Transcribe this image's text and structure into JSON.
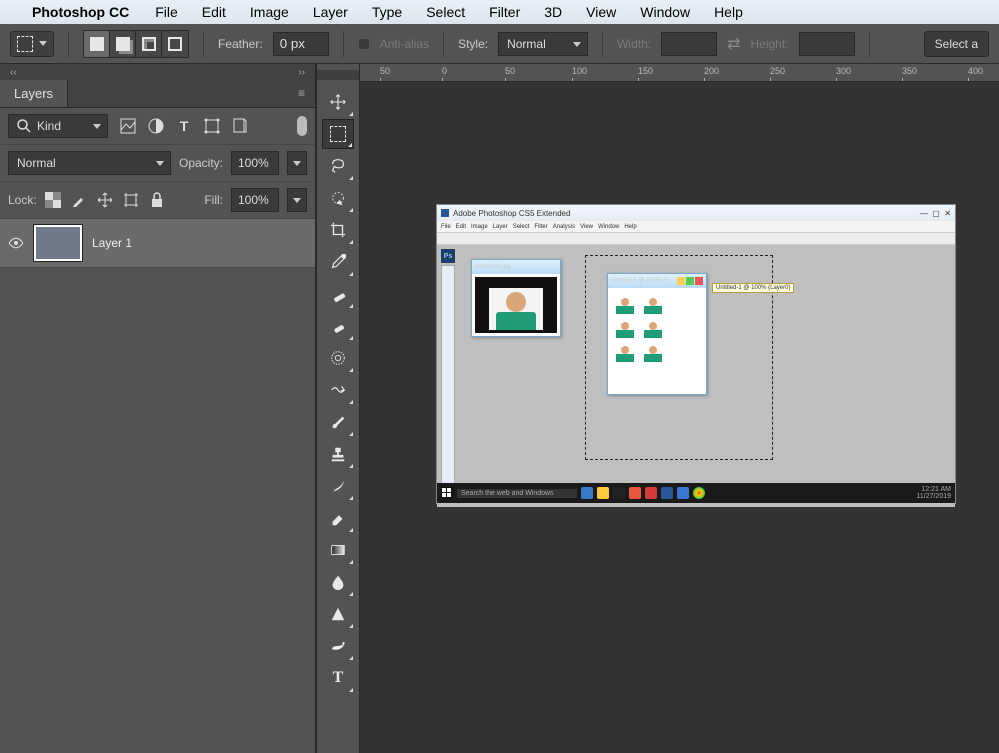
{
  "menubar": {
    "app_name": "Photoshop CC",
    "items": [
      "File",
      "Edit",
      "Image",
      "Layer",
      "Type",
      "Select",
      "Filter",
      "3D",
      "View",
      "Window",
      "Help"
    ]
  },
  "optionsbar": {
    "feather_label": "Feather:",
    "feather_value": "0 px",
    "antialias_label": "Anti-alias",
    "style_label": "Style:",
    "style_value": "Normal",
    "width_label": "Width:",
    "width_value": "",
    "height_label": "Height:",
    "height_value": "",
    "select_all": "Select a"
  },
  "layers_panel": {
    "tab": "Layers",
    "kind_label": "Kind",
    "blend_mode": "Normal",
    "opacity_label": "Opacity:",
    "opacity_value": "100%",
    "lock_label": "Lock:",
    "fill_label": "Fill:",
    "fill_value": "100%",
    "layers": [
      {
        "name": "Layer 1",
        "visible": true
      }
    ]
  },
  "collapse": {
    "left": "‹‹",
    "right": "››"
  },
  "ruler_ticks": [
    "50",
    "0",
    "50",
    "100",
    "150",
    "200",
    "250",
    "300",
    "350",
    "400"
  ],
  "canvas_image": {
    "title": "Adobe Photoshop CS5 Extended",
    "menu": [
      "File",
      "Edit",
      "Image",
      "Layer",
      "Select",
      "Filter",
      "Analysis",
      "View",
      "Window",
      "Help"
    ],
    "ps_label": "Ps",
    "doc1_title": "download.jpg",
    "doc2_title": "Untitled-1 @ 100% (L...",
    "tooltip": "Untitled-1 @ 100% (Layer0)",
    "taskbar_search": "Search the web and Windows",
    "taskbar_time": "12:21 AM",
    "taskbar_date": "11/27/2019"
  },
  "toolbar": {
    "tools": [
      {
        "name": "move-tool",
        "active": false
      },
      {
        "name": "marquee-tool",
        "active": true
      },
      {
        "name": "lasso-tool",
        "active": false
      },
      {
        "name": "quick-select-tool",
        "active": false
      },
      {
        "name": "crop-tool",
        "active": false
      },
      {
        "name": "eyedropper-tool",
        "active": false
      },
      {
        "name": "healing-brush-tool",
        "active": false
      },
      {
        "name": "brush-tool",
        "active": false
      },
      {
        "name": "clone-stamp-tool",
        "active": false
      },
      {
        "name": "history-brush-tool",
        "active": false
      },
      {
        "name": "eraser-tool",
        "active": false
      },
      {
        "name": "paint-bucket-tool",
        "active": false
      },
      {
        "name": "gradient-tool",
        "active": false
      },
      {
        "name": "blur-tool",
        "active": false
      },
      {
        "name": "dodge-tool",
        "active": false
      },
      {
        "name": "pen-tool",
        "active": false
      },
      {
        "name": "type-tool",
        "active": false
      }
    ]
  }
}
